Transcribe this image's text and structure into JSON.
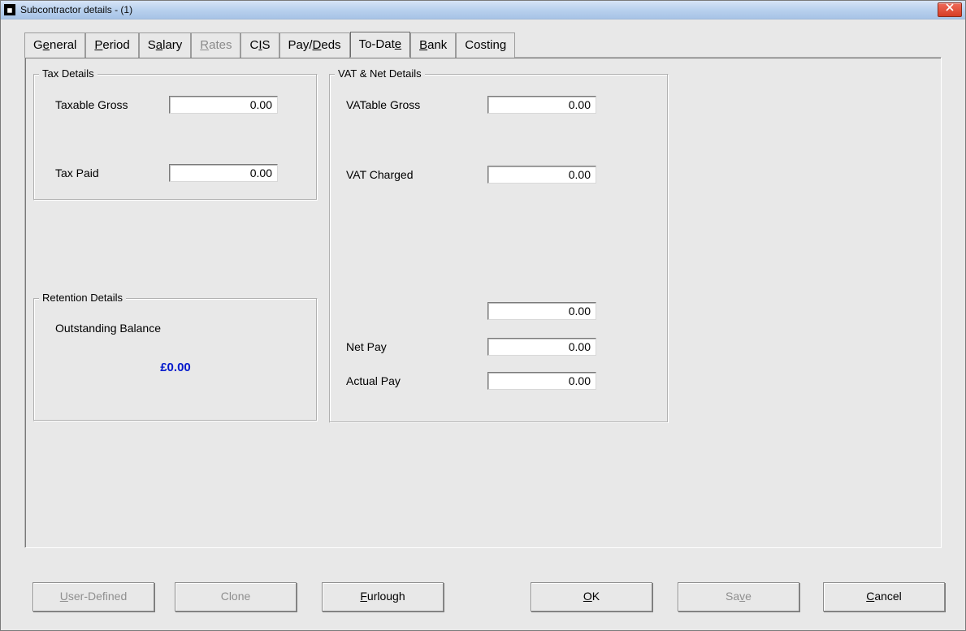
{
  "window": {
    "title": "Subcontractor details -   (1)"
  },
  "tabs": {
    "general": {
      "pre": "G",
      "u": "e",
      "post": "neral"
    },
    "period": {
      "pre": "",
      "u": "P",
      "post": "eriod"
    },
    "salary": {
      "pre": "S",
      "u": "a",
      "post": "lary"
    },
    "rates": {
      "pre": "",
      "u": "R",
      "post": "ates"
    },
    "cis": {
      "pre": "C",
      "u": "I",
      "post": "S"
    },
    "paydeds": {
      "pre": "Pay/",
      "u": "D",
      "post": "eds"
    },
    "todate": {
      "pre": "To-Dat",
      "u": "e",
      "post": ""
    },
    "bank": {
      "pre": "",
      "u": "B",
      "post": "ank"
    },
    "costing": {
      "pre": "Costin",
      "u": "g",
      "post": ""
    }
  },
  "groups": {
    "tax": {
      "legend": "Tax Details"
    },
    "retention": {
      "legend": "Retention Details"
    },
    "vat": {
      "legend": "VAT & Net Details"
    }
  },
  "fields": {
    "taxable_gross": {
      "label": "Taxable Gross",
      "value": "0.00"
    },
    "tax_paid": {
      "label": "Tax Paid",
      "value": "0.00"
    },
    "outstanding": {
      "label": "Outstanding Balance",
      "value": "£0.00"
    },
    "vatable_gross": {
      "label": "VATable Gross",
      "value": "0.00"
    },
    "vat_charged": {
      "label": "VAT Charged",
      "value": "0.00"
    },
    "blank": {
      "label": "",
      "value": "0.00"
    },
    "net_pay": {
      "label": "Net Pay",
      "value": "0.00"
    },
    "actual_pay": {
      "label": "Actual Pay",
      "value": "0.00"
    }
  },
  "buttons": {
    "userdef": {
      "pre": "",
      "u": "U",
      "post": "ser-Defined"
    },
    "clone": {
      "pre": "Clone",
      "u": "",
      "post": ""
    },
    "furlough": {
      "pre": "",
      "u": "F",
      "post": "urlough"
    },
    "ok": {
      "pre": "",
      "u": "O",
      "post": "K"
    },
    "save": {
      "pre": "Sa",
      "u": "v",
      "post": "e"
    },
    "cancel": {
      "pre": "",
      "u": "C",
      "post": "ancel"
    }
  }
}
